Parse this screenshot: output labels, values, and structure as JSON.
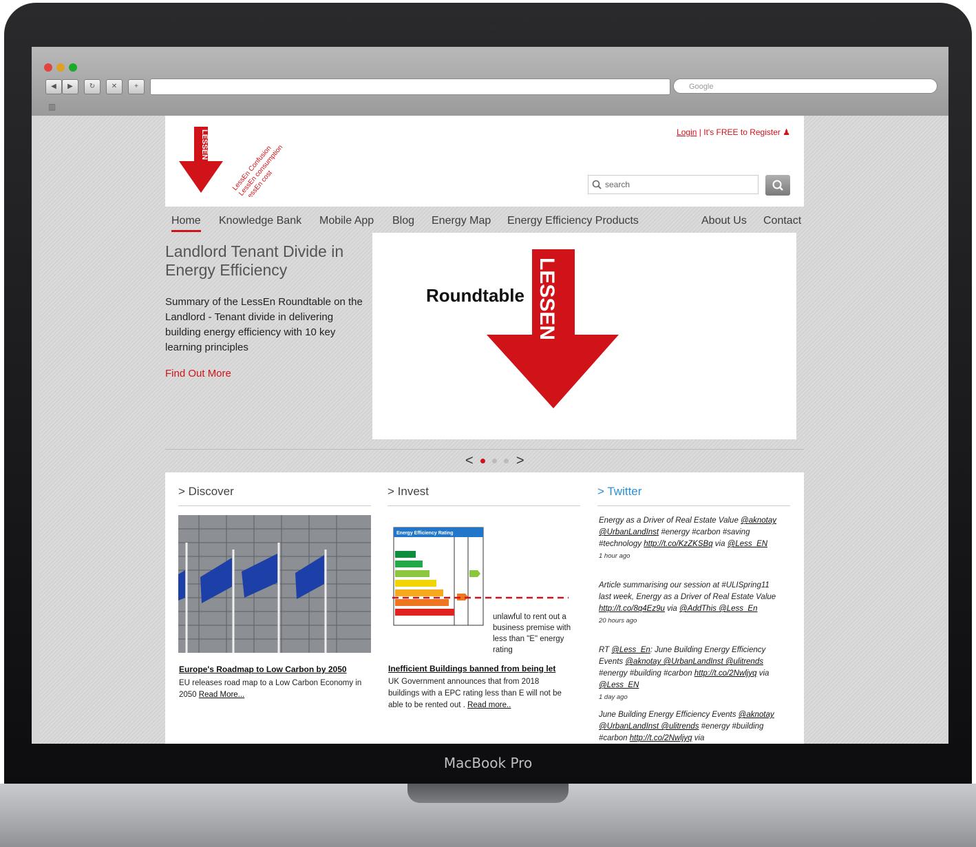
{
  "device": {
    "brand": "MacBook Pro"
  },
  "browser": {
    "search_placeholder": "Google"
  },
  "header": {
    "login": "Login",
    "register": "| It's FREE to Register",
    "search_placeholder": "search",
    "tagline": [
      "LessEn Confusion",
      "LessEn consumption",
      "LessEn cost"
    ],
    "logo_text": "LESSEN"
  },
  "menu": {
    "items": [
      "Home",
      "Knowledge Bank",
      "Mobile App",
      "Blog",
      "Energy Map",
      "Energy Efficiency Products",
      "About Us",
      "Contact"
    ]
  },
  "hero": {
    "title": "Landlord Tenant Divide in Energy Efficiency",
    "text": "Summary of the LessEn Roundtable on the Landlord - Tenant divide in delivering building energy efficiency with 10 key learning principles",
    "link": "Find Out More",
    "image_label": "Roundtable",
    "image_logo": "LESSEN"
  },
  "slider": {
    "prev": "<",
    "next": ">"
  },
  "discover": {
    "heading": "> Discover",
    "item_title": "Europe's Roadmap to Low Carbon by 2050",
    "item_text": "EU releases road map to a Low Carbon Economy in 2050",
    "read_more": "Read More..."
  },
  "invest": {
    "heading": "> Invest",
    "chart_title": "Energy Efficiency Rating",
    "chart_caption": "unlawful to rent out a business premise with less than \"E\" energy rating",
    "item_title": "Inefficient Buildings banned from being let",
    "item_text": "UK Government announces that from 2018 buildings with a EPC rating less than E will not be able to be rented out .",
    "read_more": "Read more.."
  },
  "twitter": {
    "heading": "> Twitter",
    "tweets": [
      {
        "text": "Energy as a Driver of Real Estate Value",
        "mentions": "@aknotay @UrbanLandInst",
        "rest": "#energy #carbon #saving #technology",
        "link": "http://t.co/KzZKSBq",
        "via": "via",
        "via_user": "@Less_EN",
        "time": "1 hour ago"
      },
      {
        "text": "Article summarising our session at #ULISpring11 last week, Energy as a Driver of Real Estate Value",
        "link": "http://t.co/8q4Ez9u",
        "via": "via",
        "via_user": "@AddThis @Less_En",
        "time": "20 hours ago"
      },
      {
        "text": "RT",
        "mentions": "@Less_En",
        "rest": ": June Building Energy Efficiency Events",
        "mentions2": "@aknotay @UrbanLandInst @ulitrends",
        "rest2": "#energy #building #carbon",
        "link": "http://t.co/2Nwljyq",
        "via": "via",
        "via_user": "@Less_EN",
        "time": "1 day ago"
      },
      {
        "text": "June Building Energy Efficiency Events",
        "mentions": "@aknotay @UrbanLandInst @ulitrends",
        "rest": "#energy #building #carbon",
        "link": "http://t.co/2Nwljyq",
        "via": "via"
      }
    ]
  },
  "colors": {
    "brand_red": "#d01219",
    "twitter_blue": "#2b8fd8"
  }
}
